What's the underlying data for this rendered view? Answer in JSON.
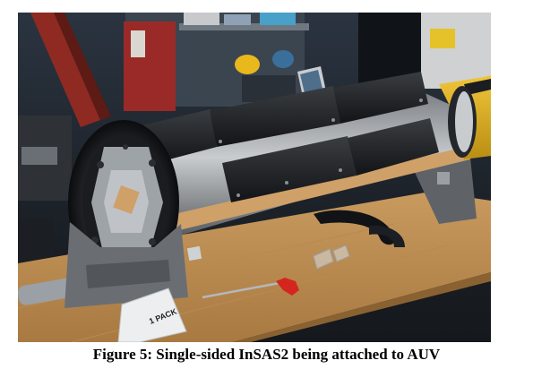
{
  "figure": {
    "caption": "Figure 5: Single-sided InSAS2 being attached to AUV",
    "photo_labels": {
      "bag_label": "1 PACK"
    }
  }
}
